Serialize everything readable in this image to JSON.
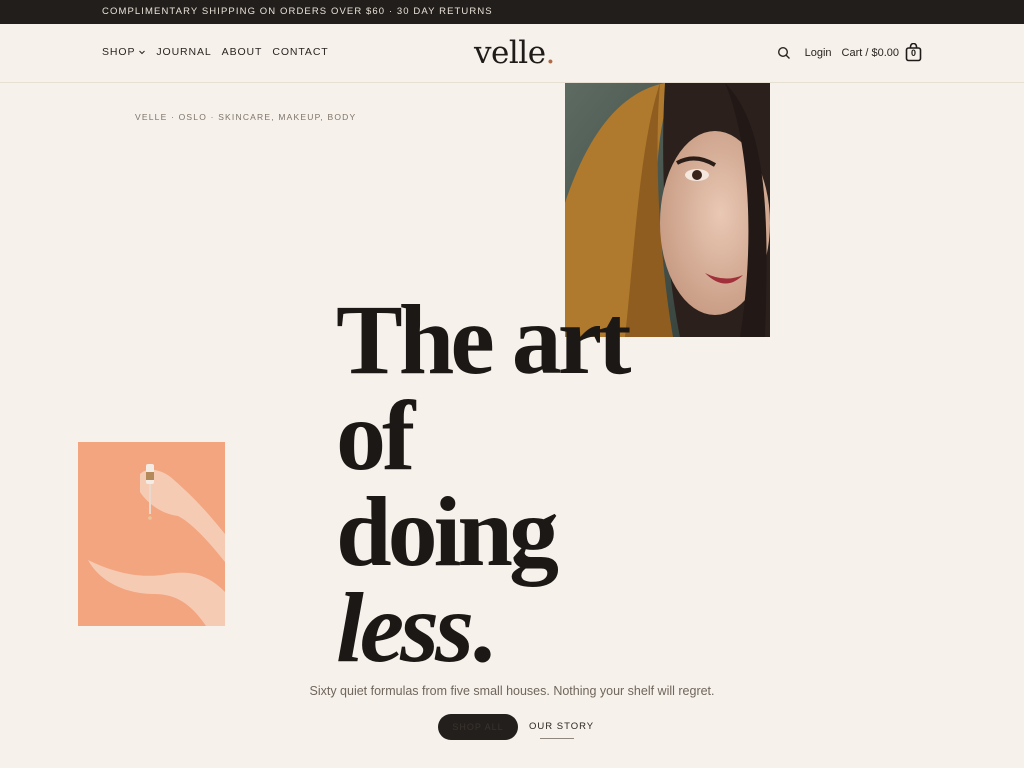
{
  "announcement": "COMPLIMENTARY SHIPPING ON ORDERS OVER $60 · 30 DAY RETURNS",
  "nav": {
    "shop": "SHOP",
    "journal": "JOURNAL",
    "about": "ABOUT",
    "contact": "CONTACT"
  },
  "logo": {
    "text": "velle",
    "dot": "."
  },
  "utility": {
    "login": "Login",
    "cart": "Cart / $0.00",
    "cart_count": "0"
  },
  "hero": {
    "eyebrow": "VELLE · OSLO · SKINCARE, MAKEUP, BODY",
    "headline_line1": "The art of",
    "headline_line2_a": "doing ",
    "headline_line2_b": "less",
    "headline_line2_c": ".",
    "tagline": "Sixty quiet formulas from five small houses. Nothing your shelf will regret.",
    "cta_primary": "SHOP ALL",
    "cta_secondary": "OUR STORY"
  },
  "colors": {
    "background": "#f6f1ea",
    "announcement_bar": "#221e1b",
    "logo_dot": "#b06a45",
    "peach_tile": "#f2a57f",
    "button_dark": "#231f1c"
  },
  "icons": [
    "search-icon",
    "bag-icon",
    "chevron-down-icon"
  ]
}
